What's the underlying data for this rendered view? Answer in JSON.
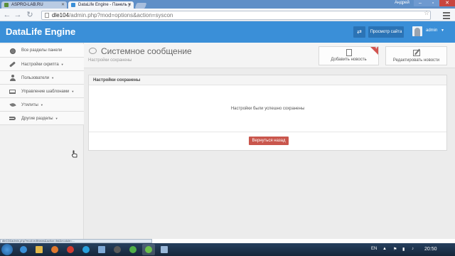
{
  "browser": {
    "tabs": [
      {
        "label": "ASPRO-LAB.RU"
      },
      {
        "label": "DataLife Engine - Панель у"
      }
    ],
    "user": "Андрей",
    "url_host": "dle104",
    "url_path": "/admin.php?mod=options&action=syscon",
    "status_url": "dle104/admin.php?mod=editnews&action=list&module=..."
  },
  "header": {
    "brand": "DataLife Engine",
    "view_site": "Просмотр сайта",
    "username": "admin"
  },
  "sidebar": {
    "items": [
      {
        "label": "Все разделы панели",
        "icon": "globe-icon",
        "arrow": ""
      },
      {
        "label": "Настройки скрипта",
        "icon": "wrench-icon",
        "arrow": "▼"
      },
      {
        "label": "Пользователи",
        "icon": "user-icon",
        "arrow": "▼"
      },
      {
        "label": "Управление шаблонами",
        "icon": "laptop-icon",
        "arrow": "▼"
      },
      {
        "label": "Утилиты",
        "icon": "leaf-icon",
        "arrow": "▼"
      },
      {
        "label": "Другие разделы",
        "icon": "share-icon",
        "arrow": "▼"
      }
    ]
  },
  "page": {
    "title": "Системное сообщение",
    "subtitle": "Настройки сохранены",
    "add_news": "Добавить новость",
    "add_news_badge": "+",
    "edit_news": "Редактировать новости"
  },
  "panel": {
    "heading": "Настройки сохранены",
    "message": "Настройки были успешно сохранены",
    "back_button": "Вернуться назад"
  },
  "taskbar": {
    "lang": "EN",
    "time": "20:50"
  },
  "colors": {
    "header": "#3a8fd8",
    "back_button": "#c9564c",
    "badge": "#d25450"
  }
}
